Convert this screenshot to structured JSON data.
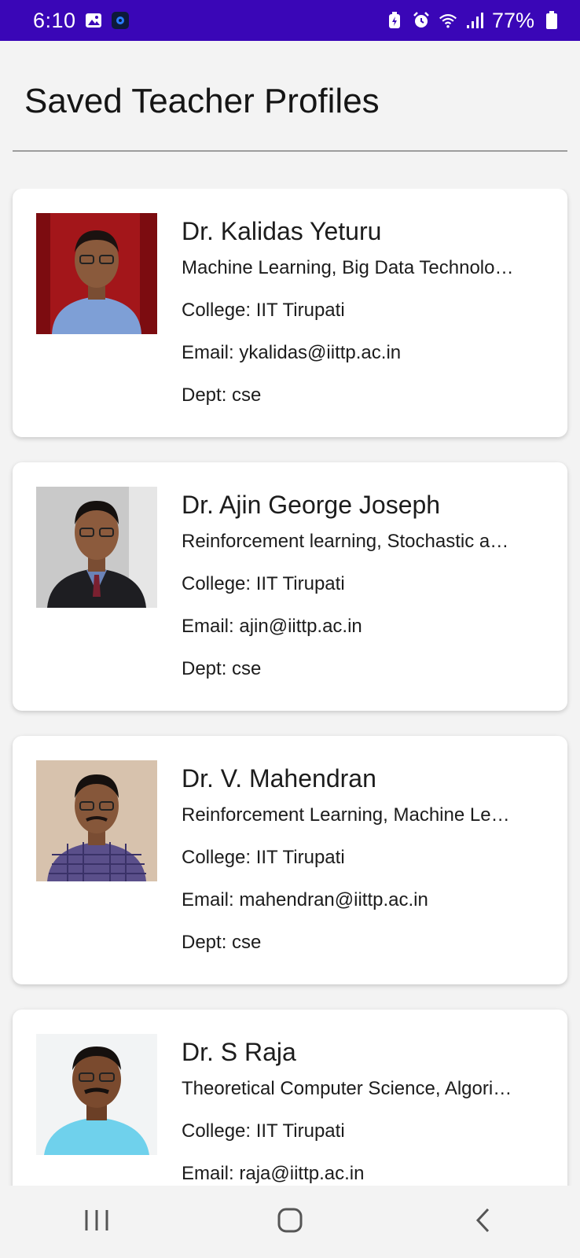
{
  "status_bar": {
    "time": "6:10",
    "battery": "77%",
    "left_icons": [
      "gallery-icon",
      "app-icon"
    ],
    "right_icons": [
      "battery-saver-icon",
      "alarm-icon",
      "wifi-icon",
      "signal-icon",
      "battery-icon"
    ]
  },
  "page": {
    "title": "Saved Teacher Profiles"
  },
  "profiles": [
    {
      "name": "Dr. Kalidas Yeturu",
      "interests": "Machine Learning, Big Data Technolo…",
      "college": "College: IIT Tirupati",
      "email": "Email: ykalidas@iittp.ac.in",
      "dept": "Dept: cse"
    },
    {
      "name": "Dr. Ajin George Joseph",
      "interests": "Reinforcement learning, Stochastic a…",
      "college": "College: IIT Tirupati",
      "email": "Email: ajin@iittp.ac.in",
      "dept": "Dept: cse"
    },
    {
      "name": "Dr. V. Mahendran",
      "interests": "Reinforcement Learning, Machine Le…",
      "college": "College: IIT Tirupati",
      "email": "Email: mahendran@iittp.ac.in",
      "dept": "Dept: cse"
    },
    {
      "name": "Dr. S Raja",
      "interests": "Theoretical Computer Science, Algori…",
      "college": "College: IIT Tirupati",
      "email": "Email: raja@iittp.ac.in",
      "dept": ""
    }
  ],
  "nav": {
    "recent_icon": "recent-apps-icon",
    "home_icon": "home-icon",
    "back_icon": "back-icon"
  },
  "colors": {
    "status_bar": "#3a06b7",
    "background": "#f3f3f3",
    "card": "#ffffff"
  }
}
